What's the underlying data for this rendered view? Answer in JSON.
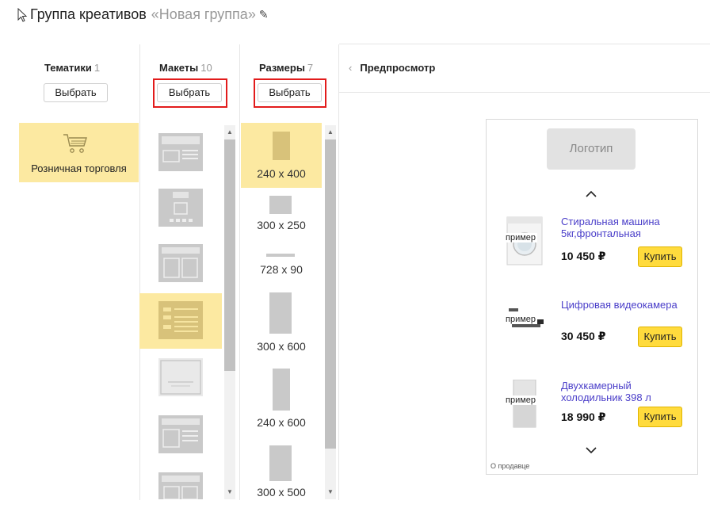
{
  "header": {
    "title": "Группа креативов",
    "group_name": "«Новая группа»",
    "edit_icon": "pencil-icon",
    "cursor_icon": "cursor-icon"
  },
  "columns": {
    "themes": {
      "label": "Тематики",
      "count": "1",
      "button": "Выбрать"
    },
    "layouts": {
      "label": "Макеты",
      "count": "10",
      "button": "Выбрать"
    },
    "sizes": {
      "label": "Размеры",
      "count": "7",
      "button": "Выбрать"
    }
  },
  "themes": [
    {
      "label": "Розничная торговля",
      "icon": "shopping-cart-icon",
      "selected": true
    }
  ],
  "sizes": [
    {
      "label": "240 x 400",
      "selected": true
    },
    {
      "label": "300 x 250",
      "selected": false
    },
    {
      "label": "728 x 90",
      "selected": false
    },
    {
      "label": "300 x 600",
      "selected": false
    },
    {
      "label": "240 x 600",
      "selected": false
    },
    {
      "label": "300 x 500",
      "selected": false
    }
  ],
  "preview": {
    "label": "Предпросмотр",
    "back_icon": "chevron-left-icon",
    "logo": "Логотип",
    "products": [
      {
        "name": "Стиральная машина 5кг,фронтальная",
        "price": "10 450 ₽",
        "tag": "пример",
        "buy": "Купить"
      },
      {
        "name": "Цифровая видеокамера",
        "price": "30 450 ₽",
        "tag": "пример",
        "buy": "Купить"
      },
      {
        "name": "Двухкамерный холодильник 398 л",
        "price": "18 990 ₽",
        "tag": "пример",
        "buy": "Купить"
      }
    ],
    "seller": "О продавце"
  },
  "colors": {
    "selected_bg": "#fce9a1",
    "highlight_border": "#e21b1b",
    "link": "#4a3ec9",
    "buy_button": "#ffdb3d"
  }
}
